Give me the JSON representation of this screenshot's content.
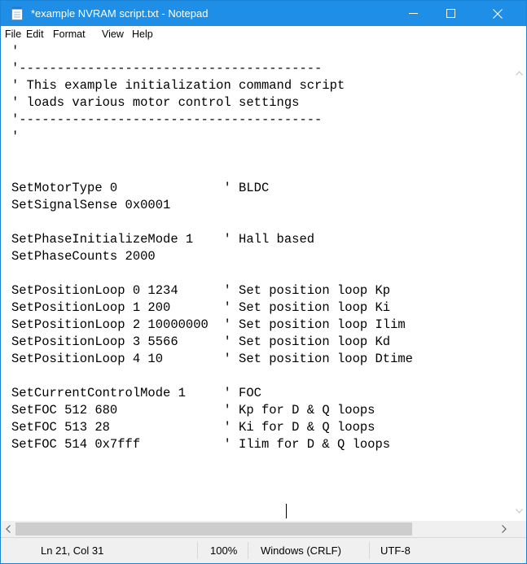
{
  "window": {
    "title": "*example NVRAM script.txt - Notepad",
    "app_icon": "notepad-icon",
    "title_bar_color": "#1f8ee6"
  },
  "menu": [
    "File",
    "Edit",
    "Format",
    "View",
    "Help"
  ],
  "editor": {
    "lines": [
      "'",
      "'----------------------------------------",
      "' This example initialization command script",
      "' loads various motor control settings",
      "'----------------------------------------",
      "'",
      "SetMotorType 0              ' BLDC",
      "SetSignalSense 0x0001",
      "",
      "SetPhaseInitializeMode 1    ' Hall based",
      "SetPhaseCounts 2000",
      "",
      "SetPositionLoop 0 1234      ' Set position loop Kp",
      "SetPositionLoop 1 200       ' Set position loop Ki",
      "SetPositionLoop 2 10000000  ' Set position loop Ilim",
      "SetPositionLoop 3 5566      ' Set position loop Kd",
      "SetPositionLoop 4 10        ' Set position loop Dtime",
      "",
      "SetCurrentControlMode 1     ' FOC",
      "SetFOC 512 680              ' Kp for D & Q loops",
      "SetFOC 513 28               ' Ki for D & Q loops",
      "SetFOC 514 0x7fff           ' Ilim for D & Q loops"
    ]
  },
  "status": {
    "position": "Ln 21, Col 31",
    "zoom": "100%",
    "line_ending": "Windows (CRLF)",
    "encoding": "UTF-8"
  }
}
